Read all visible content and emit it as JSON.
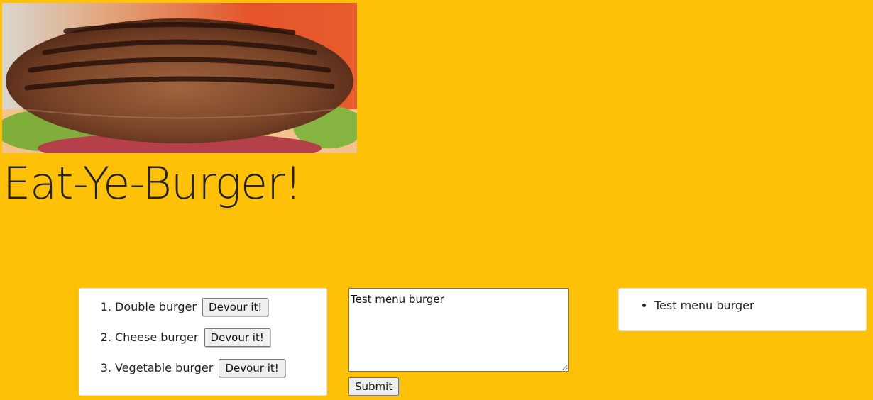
{
  "header": {
    "title": "Eat-Ye-Burger!"
  },
  "uneaten_list": {
    "items": [
      {
        "name": "Double burger",
        "button_label": "Devour it!"
      },
      {
        "name": "Cheese burger",
        "button_label": "Devour it!"
      },
      {
        "name": "Vegetable burger",
        "button_label": "Devour it!"
      }
    ]
  },
  "composer": {
    "textarea_value": "Test menu burger",
    "submit_label": "Submit"
  },
  "devoured_list": {
    "items": [
      {
        "name": "Test menu burger"
      }
    ]
  },
  "colors": {
    "background": "#FFC107",
    "card": "#FFFFFF"
  }
}
